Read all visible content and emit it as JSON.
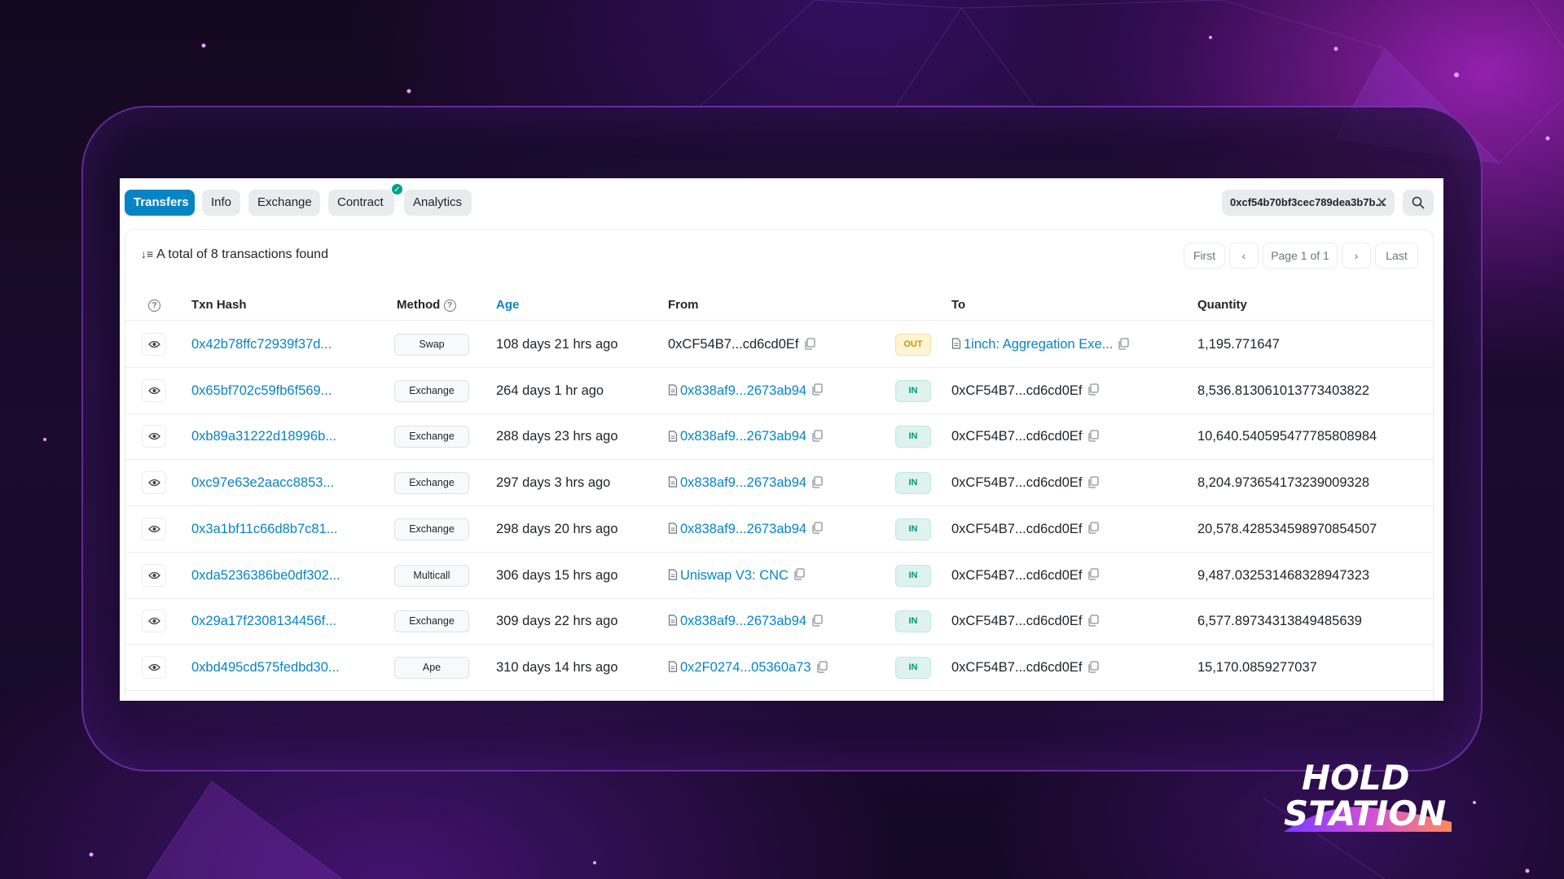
{
  "tabs": [
    {
      "label": "Transfers",
      "active": true
    },
    {
      "label": "Info",
      "active": false
    },
    {
      "label": "Exchange",
      "active": false
    },
    {
      "label": "Contract",
      "active": false,
      "verified": true
    },
    {
      "label": "Analytics",
      "active": false
    }
  ],
  "filter": {
    "address": "0xcf54b70bf3cec789dea3b7b..."
  },
  "summary": {
    "text": "A total of 8 transactions found"
  },
  "pagination": {
    "first": "First",
    "page": "Page 1 of 1",
    "last": "Last"
  },
  "columns": {
    "txn_hash": "Txn Hash",
    "method": "Method",
    "age": "Age",
    "from": "From",
    "to": "To",
    "quantity": "Quantity"
  },
  "rows": [
    {
      "hash": "0x42b78ffc72939f37d...",
      "method": "Swap",
      "age": "108 days 21 hrs ago",
      "from": "0xCF54B7...cd6cd0Ef",
      "from_is_contract": false,
      "direction": "OUT",
      "to": "1inch: Aggregation Exe...",
      "to_is_contract": true,
      "quantity": "1,195.771647"
    },
    {
      "hash": "0x65bf702c59fb6f569...",
      "method": "Exchange",
      "age": "264 days 1 hr ago",
      "from": "0x838af9...2673ab94",
      "from_is_contract": true,
      "direction": "IN",
      "to": "0xCF54B7...cd6cd0Ef",
      "to_is_contract": false,
      "quantity": "8,536.813061013773403822"
    },
    {
      "hash": "0xb89a31222d18996b...",
      "method": "Exchange",
      "age": "288 days 23 hrs ago",
      "from": "0x838af9...2673ab94",
      "from_is_contract": true,
      "direction": "IN",
      "to": "0xCF54B7...cd6cd0Ef",
      "to_is_contract": false,
      "quantity": "10,640.540595477785808984"
    },
    {
      "hash": "0xc97e63e2aacc8853...",
      "method": "Exchange",
      "age": "297 days 3 hrs ago",
      "from": "0x838af9...2673ab94",
      "from_is_contract": true,
      "direction": "IN",
      "to": "0xCF54B7...cd6cd0Ef",
      "to_is_contract": false,
      "quantity": "8,204.973654173239009328"
    },
    {
      "hash": "0x3a1bf11c66d8b7c81...",
      "method": "Exchange",
      "age": "298 days 20 hrs ago",
      "from": "0x838af9...2673ab94",
      "from_is_contract": true,
      "direction": "IN",
      "to": "0xCF54B7...cd6cd0Ef",
      "to_is_contract": false,
      "quantity": "20,578.428534598970854507"
    },
    {
      "hash": "0xda5236386be0df302...",
      "method": "Multicall",
      "age": "306 days 15 hrs ago",
      "from": "Uniswap V3: CNC",
      "from_is_contract": true,
      "direction": "IN",
      "to": "0xCF54B7...cd6cd0Ef",
      "to_is_contract": false,
      "quantity": "9,487.032531468328947323"
    },
    {
      "hash": "0x29a17f2308134456f...",
      "method": "Exchange",
      "age": "309 days 22 hrs ago",
      "from": "0x838af9...2673ab94",
      "from_is_contract": true,
      "direction": "IN",
      "to": "0xCF54B7...cd6cd0Ef",
      "to_is_contract": false,
      "quantity": "6,577.89734313849485639"
    },
    {
      "hash": "0xbd495cd575fedbd30...",
      "method": "Ape",
      "age": "310 days 14 hrs ago",
      "from": "0x2F0274...05360a73",
      "from_is_contract": true,
      "direction": "IN",
      "to": "0xCF54B7...cd6cd0Ef",
      "to_is_contract": false,
      "quantity": "15,170.0859277037"
    }
  ],
  "logo": {
    "line1": "HOLD",
    "line2": "STATION"
  },
  "icons": {
    "sort": "sort-descending-icon",
    "search": "search-icon",
    "close": "close-icon",
    "eye": "eye-icon",
    "copy": "copy-icon",
    "contract": "document-icon",
    "help": "question-circle-icon",
    "verified": "check-circle-icon"
  },
  "colors": {
    "accent": "#0784c3",
    "in_badge": "#02977e",
    "out_badge": "#c79500",
    "verified": "#00a186"
  }
}
